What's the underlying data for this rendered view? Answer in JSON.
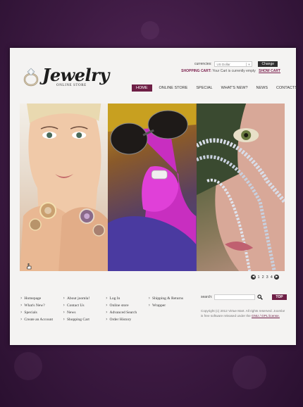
{
  "logo": {
    "title": "Jewelry",
    "subtitle": "online store"
  },
  "header": {
    "currencies_label": "currencies:",
    "currency_value": "US Dollar",
    "change_label": "Change",
    "cart_title": "Shopping Cart:",
    "cart_status": "Your Cart is currently empty",
    "show_cart": "Show Cart"
  },
  "nav": {
    "items": [
      {
        "label": "Home",
        "active": true
      },
      {
        "label": "Online store"
      },
      {
        "label": "Special"
      },
      {
        "label": "What's new?"
      },
      {
        "label": "News"
      },
      {
        "label": "Contacts"
      }
    ]
  },
  "pager": {
    "pages": [
      "1",
      "2",
      "3",
      "4"
    ],
    "prev_icon": "arrow-left-icon",
    "next_icon": "arrow-right-icon"
  },
  "footer": {
    "col1": [
      "Homepage",
      "What's New?",
      "Specials",
      "Create an Account"
    ],
    "col2": [
      "About joomla!",
      "Contact Us",
      "News",
      "Shopping Cart"
    ],
    "col3": [
      "Log In",
      "Online store",
      "Advanced Search",
      "Order History"
    ],
    "col4": [
      "Shipping & Returns",
      "Wrapper"
    ]
  },
  "search": {
    "label": "search:",
    "top_label": "TOP"
  },
  "copyright": {
    "text": "Copyright (c) 2012 Virtue Mart. All rights reserved. Joomla! is free software released under the",
    "license": "GNU / GPL license."
  },
  "colors": {
    "accent": "#6e1f46",
    "background": "#3d1a42",
    "page": "#f4f3f2"
  }
}
